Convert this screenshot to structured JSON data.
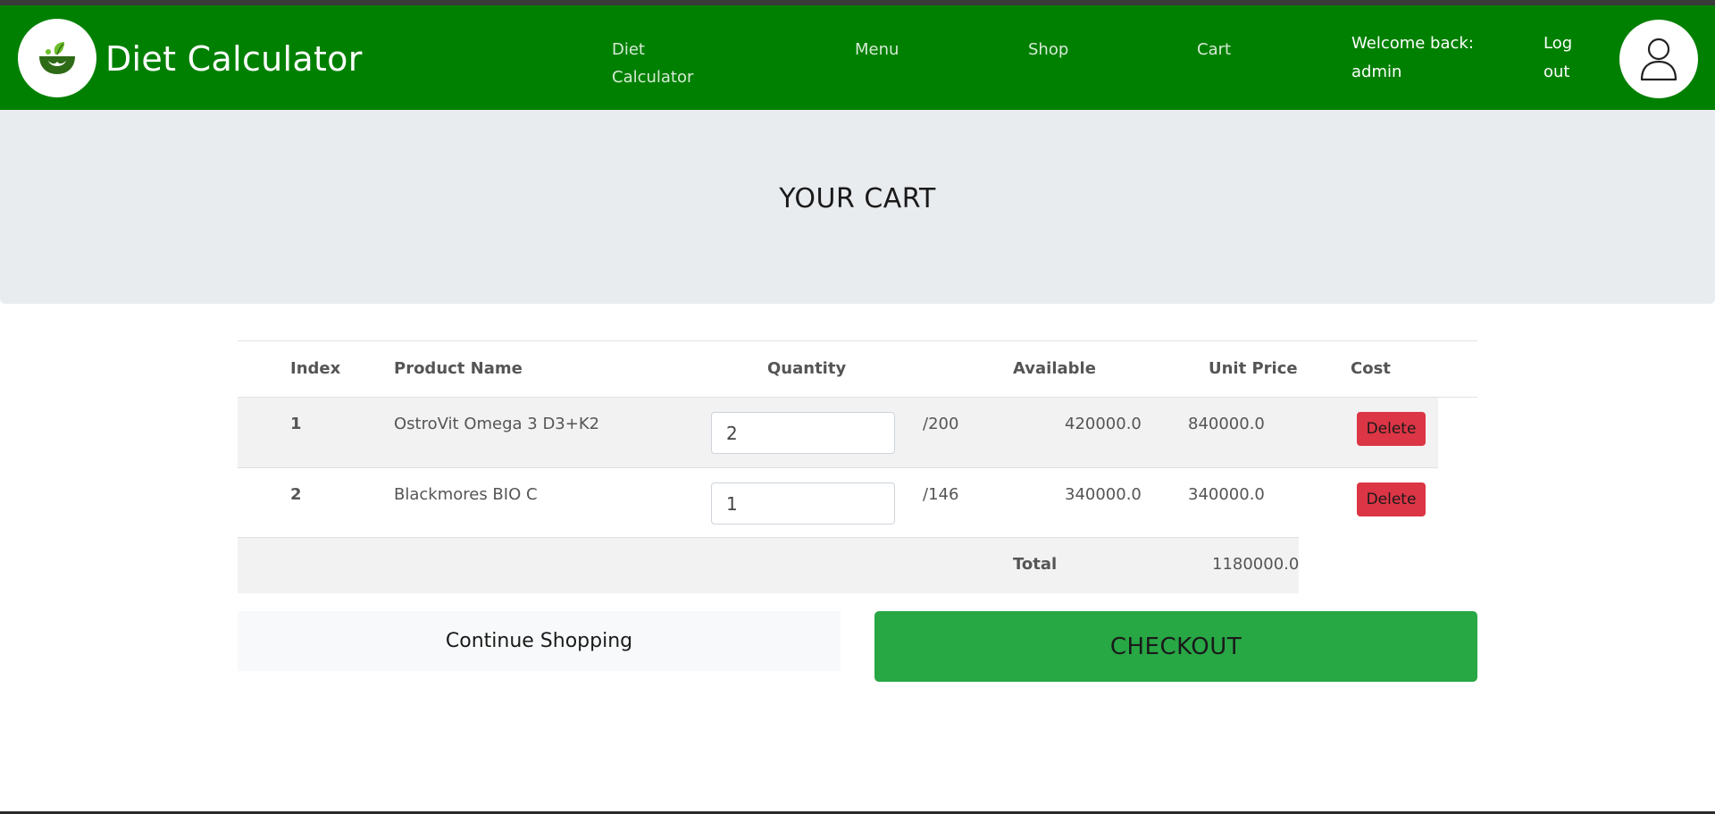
{
  "header": {
    "brand": "Diet Calculator",
    "nav": {
      "diet_calculator": "Diet Calculator",
      "menu": "Menu",
      "shop": "Shop",
      "cart": "Cart"
    },
    "welcome": "Welcome back: admin",
    "logout": "Log out",
    "logo_icon": "bowl-leaf-logo",
    "avatar_icon": "user-icon"
  },
  "hero": {
    "title": "YOUR CART"
  },
  "table": {
    "headers": {
      "index": "Index",
      "product": "Product Name",
      "quantity": "Quantity",
      "available": "Available",
      "unit_price": "Unit Price",
      "cost": "Cost"
    },
    "rows": [
      {
        "index": "1",
        "product": "OstroVit Omega 3 D3+K2",
        "quantity": "2",
        "available": "/200",
        "unit_price": "420000.0",
        "cost": "840000.0",
        "action": "Delete"
      },
      {
        "index": "2",
        "product": "Blackmores BIO C",
        "quantity": "1",
        "available": "/146",
        "unit_price": "340000.0",
        "cost": "340000.0",
        "action": "Delete"
      }
    ],
    "total_label": "Total",
    "total_value": "1180000.0"
  },
  "actions": {
    "continue": "Continue Shopping",
    "checkout": "CHECKOUT"
  },
  "colors": {
    "navbar": "#008000",
    "hero": "#e9ecef",
    "delete": "#dc3545",
    "checkout": "#28a745"
  }
}
